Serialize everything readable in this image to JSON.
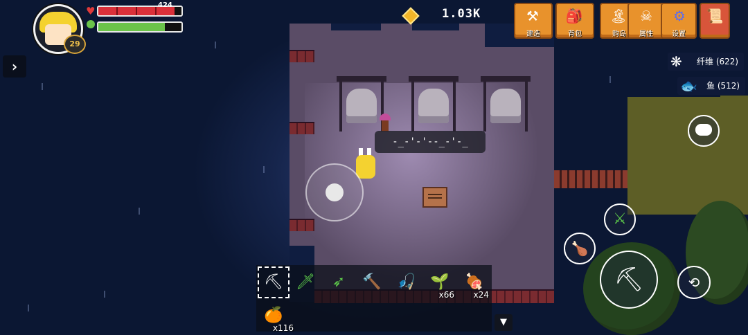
{
  "player": {
    "level": "29",
    "hp_text": "424",
    "hp_fraction": 0.92,
    "energy_fraction": 0.8
  },
  "currency": {
    "amount": "1.03K"
  },
  "menu": {
    "items": [
      {
        "label": "建造",
        "icon": "build-icon"
      },
      {
        "label": "背包",
        "icon": "backpack-icon"
      },
      {
        "label": "购岛",
        "icon": "buy-island-icon"
      },
      {
        "label": "属性",
        "icon": "stats-icon"
      },
      {
        "label": "设置",
        "icon": "settings-gear-icon"
      },
      {
        "label": "",
        "icon": "map-scroll-icon"
      }
    ]
  },
  "resources": [
    {
      "label": "纤维 (622)",
      "icon": "fiber-icon"
    },
    {
      "label": "鱼 (512)",
      "icon": "fish-icon"
    }
  ],
  "speech": {
    "text": "-_-'-'--_-'-_"
  },
  "hotbar": {
    "slots": [
      {
        "icon": "pickaxe-icon",
        "count": ""
      },
      {
        "icon": "green-sword-icon",
        "count": ""
      },
      {
        "icon": "bow-icon",
        "count": ""
      },
      {
        "icon": "hammer-icon",
        "count": ""
      },
      {
        "icon": "fishing-rod-icon",
        "count": ""
      },
      {
        "icon": "sprout-icon",
        "count": "x66"
      },
      {
        "icon": "meat-icon",
        "count": "x24"
      },
      {
        "icon": "orange-fruit-icon",
        "count": "x116"
      }
    ]
  },
  "colors": {
    "hp": "#d9303a",
    "energy": "#6bc44a",
    "menu": "#e8922c"
  }
}
